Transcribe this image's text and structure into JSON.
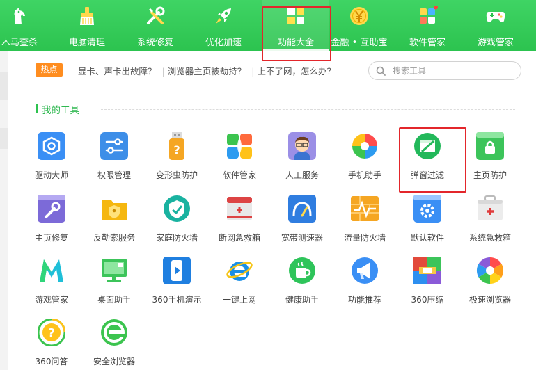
{
  "nav": [
    {
      "label": "木马查杀",
      "icon": "horse-icon",
      "active": false
    },
    {
      "label": "电脑清理",
      "icon": "broom-icon",
      "active": false
    },
    {
      "label": "系统修复",
      "icon": "wrench-screwdriver-icon",
      "active": false
    },
    {
      "label": "优化加速",
      "icon": "rocket-icon",
      "active": false
    },
    {
      "label": "功能大全",
      "icon": "grid-icon",
      "active": true
    },
    {
      "label": "金融 • 互助宝",
      "icon": "yen-coin-icon",
      "active": false
    },
    {
      "label": "软件管家",
      "icon": "software-cube-icon",
      "active": false
    },
    {
      "label": "游戏管家",
      "icon": "gamepad-icon",
      "active": false
    }
  ],
  "hot": {
    "badge": "热点",
    "links": [
      "显卡、声卡出故障？",
      "浏览器主页被劫持？",
      "上不了网，怎么办？"
    ]
  },
  "search": {
    "placeholder": "搜索工具"
  },
  "section": {
    "title": "我的工具"
  },
  "tools": [
    {
      "label": "驱动大师",
      "icon": "driver-master-icon"
    },
    {
      "label": "权限管理",
      "icon": "permission-toggle-icon"
    },
    {
      "label": "变形虫防护",
      "icon": "usb-shield-icon"
    },
    {
      "label": "软件管家",
      "icon": "software-manager-icon"
    },
    {
      "label": "人工服务",
      "icon": "human-service-avatar-icon"
    },
    {
      "label": "手机助手",
      "icon": "phone-assistant-icon"
    },
    {
      "label": "弹窗过滤",
      "icon": "popup-filter-icon"
    },
    {
      "label": "主页防护",
      "icon": "homepage-lock-icon"
    },
    {
      "label": "主页修复",
      "icon": "homepage-repair-icon"
    },
    {
      "label": "反勒索服务",
      "icon": "anti-ransom-folder-icon"
    },
    {
      "label": "家庭防火墙",
      "icon": "family-firewall-icon"
    },
    {
      "label": "断网急救箱",
      "icon": "network-firstaid-icon"
    },
    {
      "label": "宽带测速器",
      "icon": "speed-gauge-icon"
    },
    {
      "label": "流量防火墙",
      "icon": "traffic-firewall-icon"
    },
    {
      "label": "默认软件",
      "icon": "default-software-gear-icon"
    },
    {
      "label": "系统急救箱",
      "icon": "system-firstaid-icon"
    },
    {
      "label": "游戏管家",
      "icon": "game-manager-m-icon"
    },
    {
      "label": "桌面助手",
      "icon": "desktop-helper-icon"
    },
    {
      "label": "360手机演示",
      "icon": "phone-demo-icon"
    },
    {
      "label": "一键上网",
      "icon": "ie-browser-icon"
    },
    {
      "label": "健康助手",
      "icon": "health-cup-icon"
    },
    {
      "label": "功能推荐",
      "icon": "megaphone-icon"
    },
    {
      "label": "360压缩",
      "icon": "zip-compress-icon"
    },
    {
      "label": "极速浏览器",
      "icon": "chrome-browser-icon"
    },
    {
      "label": "360问答",
      "icon": "qa-question-icon"
    },
    {
      "label": "安全浏览器",
      "icon": "safe-browser-icon"
    }
  ],
  "colors": {
    "accent": "#2cc34f",
    "highlight_frame": "#e3262b",
    "hot_badge": "#ff8d1f"
  }
}
